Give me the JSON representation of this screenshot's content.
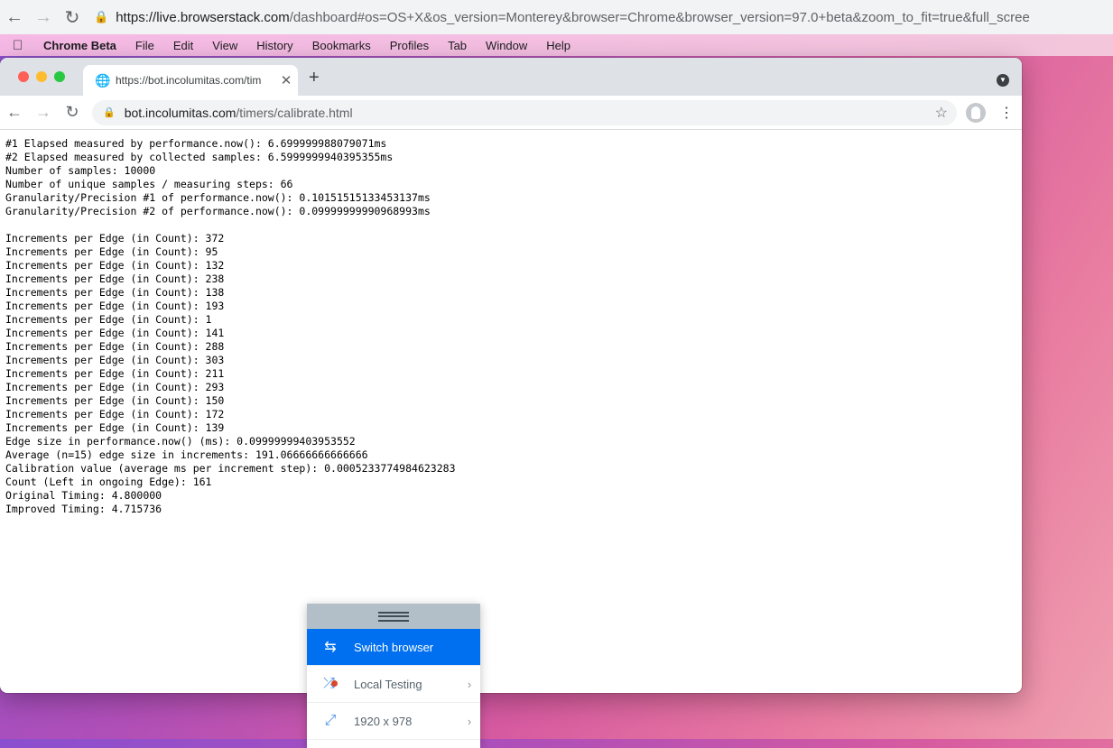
{
  "outer_browser": {
    "url_host": "https://live.browserstack.com",
    "url_path": "/dashboard#os=OS+X&os_version=Monterey&browser=Chrome&browser_version=97.0+beta&zoom_to_fit=true&full_scree"
  },
  "menubar": {
    "app": "Chrome Beta",
    "items": [
      "File",
      "Edit",
      "View",
      "History",
      "Bookmarks",
      "Profiles",
      "Tab",
      "Window",
      "Help"
    ]
  },
  "tab": {
    "title": "https://bot.incolumitas.com/tim"
  },
  "omnibox": {
    "host": "bot.incolumitas.com",
    "path": "/timers/calibrate.html"
  },
  "content": {
    "lines": [
      "#1 Elapsed measured by performance.now(): 6.699999988079071ms",
      "#2 Elapsed measured by collected samples: 6.5999999940395355ms",
      "Number of samples: 10000",
      "Number of unique samples / measuring steps: 66",
      "Granularity/Precision #1 of performance.now(): 0.10151515133453137ms",
      "Granularity/Precision #2 of performance.now(): 0.09999999990968993ms",
      "",
      "Increments per Edge (in Count): 372",
      "Increments per Edge (in Count): 95",
      "Increments per Edge (in Count): 132",
      "Increments per Edge (in Count): 238",
      "Increments per Edge (in Count): 138",
      "Increments per Edge (in Count): 193",
      "Increments per Edge (in Count): 1",
      "Increments per Edge (in Count): 141",
      "Increments per Edge (in Count): 288",
      "Increments per Edge (in Count): 303",
      "Increments per Edge (in Count): 211",
      "Increments per Edge (in Count): 293",
      "Increments per Edge (in Count): 150",
      "Increments per Edge (in Count): 172",
      "Increments per Edge (in Count): 139",
      "Edge size in performance.now() (ms): 0.09999999403953552",
      "Average (n=15) edge size in increments: 191.06666666666666",
      "Calibration value (average ms per increment step): 0.0005233774984623283",
      "Count (Left in ongoing Edge): 161",
      "Original Timing: 4.800000",
      "Improved Timing: 4.715736"
    ]
  },
  "panel": {
    "switch_browser": "Switch browser",
    "local_testing": "Local Testing",
    "resolution": "1920 x 978"
  }
}
